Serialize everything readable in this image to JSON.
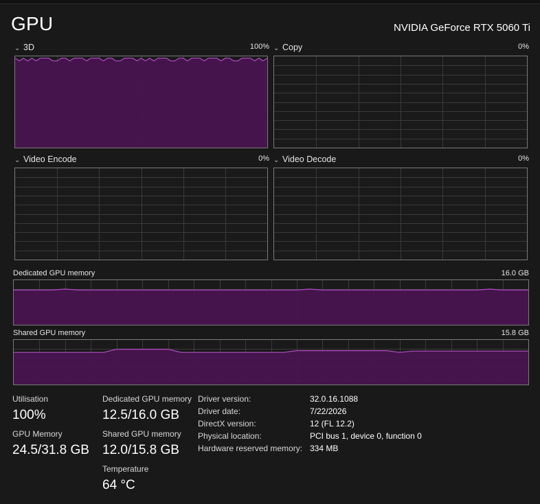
{
  "header": {
    "title": "GPU",
    "gpu_name": "NVIDIA GeForce RTX 5060 Ti"
  },
  "engines": [
    {
      "label": "3D",
      "percent_label": "100%",
      "utilization": 0.98
    },
    {
      "label": "Copy",
      "percent_label": "0%",
      "utilization": 0
    },
    {
      "label": "Video Encode",
      "percent_label": "0%",
      "utilization": 0
    },
    {
      "label": "Video Decode",
      "percent_label": "0%",
      "utilization": 0
    }
  ],
  "dedicated_memory_graph": {
    "label": "Dedicated GPU memory",
    "max_label": "16.0 GB",
    "level": 0.78
  },
  "shared_memory_graph": {
    "label": "Shared GPU memory",
    "max_label": "15.8 GB",
    "level": 0.72
  },
  "stats": {
    "utilisation": {
      "label": "Utilisation",
      "value": "100%"
    },
    "gpu_memory": {
      "label": "GPU Memory",
      "value": "24.5/31.8 GB"
    },
    "dedicated": {
      "label": "Dedicated GPU memory",
      "value": "12.5/16.0 GB"
    },
    "shared": {
      "label": "Shared GPU memory",
      "value": "12.0/15.8 GB"
    },
    "temperature": {
      "label": "Temperature",
      "value": "64 °C"
    }
  },
  "info": [
    {
      "key": "Driver version:",
      "value": "32.0.16.1088"
    },
    {
      "key": "Driver date:",
      "value": "7/22/2026"
    },
    {
      "key": "DirectX version:",
      "value": "12 (FL 12.2)"
    },
    {
      "key": "Physical location:",
      "value": "PCI bus 1, device 0, function 0"
    },
    {
      "key": "Hardware reserved memory:",
      "value": "334 MB"
    }
  ],
  "colors": {
    "accent_line": "#b34fc6",
    "accent_fill": "#4a1450",
    "grid": "#3a3a3a",
    "graph_border": "#7a7a7a"
  }
}
